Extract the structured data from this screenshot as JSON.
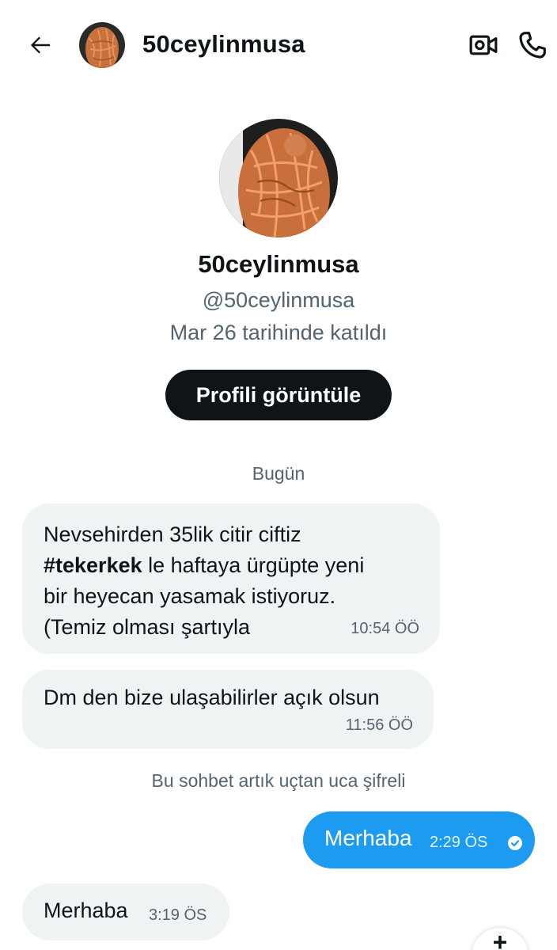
{
  "header": {
    "title": "50ceylinmusa",
    "back_icon": "arrow-left-icon",
    "video_icon": "video-camera-icon",
    "call_icon": "phone-icon"
  },
  "profile": {
    "name": "50ceylinmusa",
    "handle": "@50ceylinmusa",
    "joined": "Mar 26 tarihinde katıldı",
    "view_button": "Profili görüntüle"
  },
  "conversation": {
    "date_divider": "Bugün",
    "encryption_notice": "Bu sohbet artık uçtan uca şifreli",
    "messages": [
      {
        "sender": "them",
        "line1": "Nevsehirden 35lik citir ciftiz",
        "hashtag": "#tekerkek",
        "line2_rest": " le haftaya ürgüpte yeni",
        "line3": "bir heyecan yasamak istiyoruz.",
        "line4": "(Temiz olması şartıyla",
        "time": "10:54 ÖÖ"
      },
      {
        "sender": "them",
        "text": "Dm den bize ulaşabilirler açık olsun",
        "time": "11:56 ÖÖ"
      },
      {
        "sender": "me",
        "text": "Merhaba",
        "time": "2:29 ÖS",
        "status_icon": "check-circle-icon"
      },
      {
        "sender": "them",
        "text": "Merhaba",
        "time": "3:19 ÖS"
      }
    ]
  },
  "colors": {
    "accent": "#1d9bf0",
    "incoming_bubble": "#eff3f4",
    "primary_text": "#0f1419",
    "secondary_text": "#536471"
  }
}
